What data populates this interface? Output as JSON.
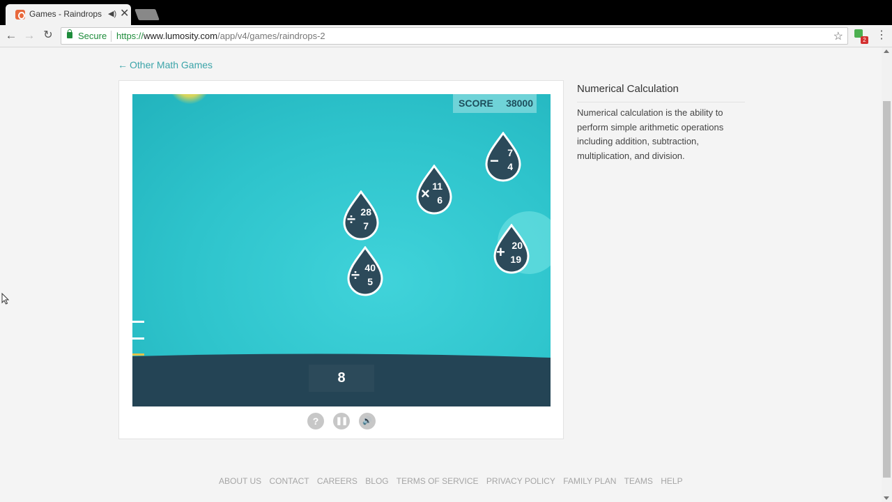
{
  "browser": {
    "tab_title": "Games - Raindrops - L",
    "tab_audio_icon": "speaker-icon",
    "tab_close": "✕",
    "secure_label": "Secure",
    "url_scheme": "https://",
    "url_host": "www.lumosity.com",
    "url_path": "/app/v4/games/raindrops-2",
    "extension_badge": "2"
  },
  "page": {
    "back_arrow": "←",
    "back_link_label": "Other Math Games"
  },
  "game": {
    "score_label": "SCORE",
    "score_value": "38000",
    "answer_value": "8",
    "drops": [
      {
        "operator": "−",
        "top": "7",
        "bottom": "4"
      },
      {
        "operator": "×",
        "top": "11",
        "bottom": "6"
      },
      {
        "operator": "÷",
        "top": "28",
        "bottom": "7"
      },
      {
        "operator": "+",
        "top": "20",
        "bottom": "19"
      },
      {
        "operator": "÷",
        "top": "40",
        "bottom": "5"
      }
    ],
    "controls": {
      "help": "?",
      "pause": "❚❚",
      "sound": "🔊"
    },
    "colors": {
      "water": "#2ec4cc",
      "drop_fill": "#2c4a5a",
      "ground": "#244455",
      "score_bg": "#6fd3d8"
    }
  },
  "info": {
    "title": "Numerical Calculation",
    "description": "Numerical calculation is the ability to perform simple arithmetic operations including addition, subtraction, multiplication, and division."
  },
  "footer": {
    "links": [
      "ABOUT US",
      "CONTACT",
      "CAREERS",
      "BLOG",
      "TERMS OF SERVICE",
      "PRIVACY POLICY",
      "FAMILY PLAN",
      "TEAMS",
      "HELP"
    ]
  }
}
